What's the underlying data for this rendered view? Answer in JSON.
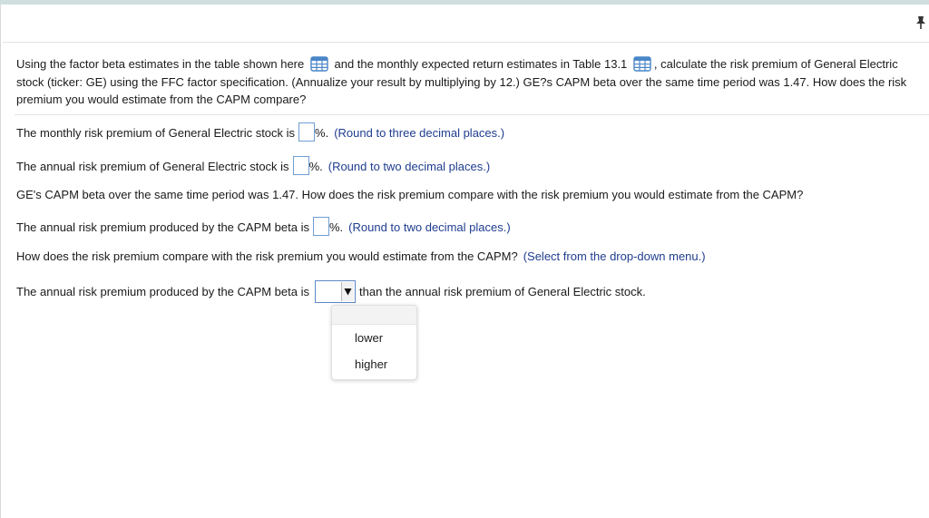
{
  "question": {
    "text_1": "Using the factor beta estimates in the table shown here",
    "text_2": "and the monthly expected return estimates in Table 13.1",
    "text_3": ", calculate the risk premium of General Electric stock (ticker: GE) using the FFC factor specification. (Annualize your result by multiplying by 12.) GE?s CAPM beta over the same time period was 1.47. How does the risk premium you would estimate from the CAPM compare?"
  },
  "items": {
    "monthly": {
      "label": "The monthly risk premium of General Electric stock is",
      "unit": "%.",
      "hint": "(Round to three decimal places.)",
      "value": ""
    },
    "annual": {
      "label": "The annual risk premium of General Electric stock is",
      "unit": "%.",
      "hint": "(Round to two decimal places.)",
      "value": ""
    },
    "capm_note": "GE's CAPM beta over the same time period was 1.47. How does the risk premium compare with the risk premium you would estimate from the CAPM?",
    "capm_annual": {
      "label": "The annual risk premium produced by the CAPM beta is",
      "unit": "%.",
      "hint": "(Round to two decimal places.)",
      "value": ""
    },
    "compare_question": "How does the risk premium compare with the risk premium you would estimate from the CAPM?",
    "compare_hint": "(Select from the drop-down menu.)",
    "compare": {
      "label": "The annual risk premium produced by the CAPM beta is",
      "selected": "",
      "suffix": "than the annual risk premium of General Electric stock."
    }
  },
  "dropdown": {
    "options": [
      "lower",
      "higher"
    ]
  },
  "icons": {
    "table": "table-grid-icon",
    "pin": "pin-icon",
    "dropdown_arrow": "triangle-down-icon"
  },
  "colors": {
    "hint_text": "#1f3d8f",
    "input_border": "#6f9ed3",
    "icon_blue": "#4a86c8",
    "top_bar": "#cfdfe0"
  }
}
